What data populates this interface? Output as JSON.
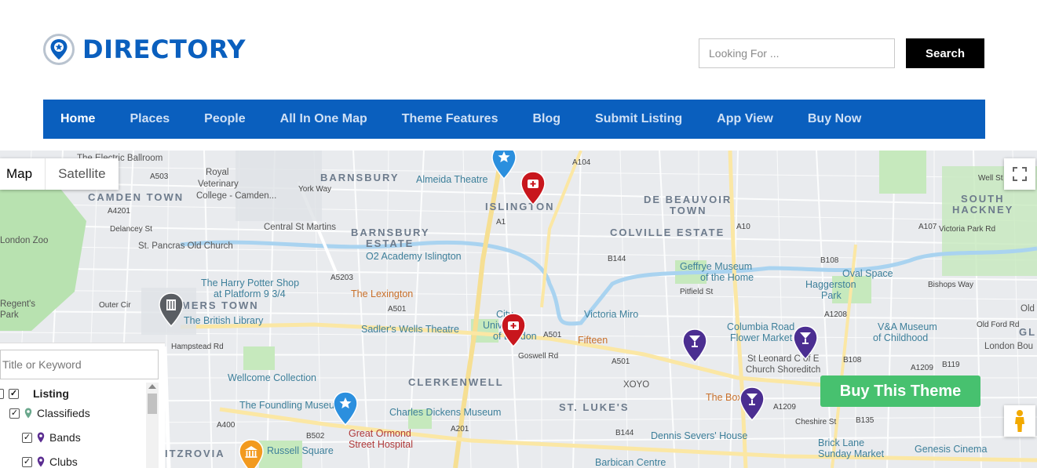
{
  "header": {
    "logo_text": "DIRECTORY",
    "search_placeholder": "Looking For ...",
    "search_button": "Search"
  },
  "nav": {
    "items": [
      "Home",
      "Places",
      "People",
      "All In One Map",
      "Theme Features",
      "Blog",
      "Submit Listing",
      "App View",
      "Buy Now"
    ],
    "active": "Home"
  },
  "map": {
    "type_controls": {
      "map": "Map",
      "satellite": "Satellite"
    },
    "buy_button": "Buy This Theme",
    "districts": [
      "CAMDEN TOWN",
      "BARNSBURY",
      "ISLINGTON",
      "DE BEAUVOIR",
      "TOWN",
      "SOUTH",
      "HACKNEY",
      "BARNSBURY",
      "ESTATE",
      "COLVILLE ESTATE",
      "MERS TOWN",
      "CLERKENWELL",
      "ST. LUKE'S",
      "ITZROVIA"
    ],
    "places": [
      "The Electric Ballroom",
      "Royal",
      "Veterinary",
      "College - Camden...",
      "Almeida Theatre",
      "Central St Martins",
      "St. Pancras Old Church",
      "O2 Academy Islington",
      "The Harry Potter Shop",
      "at Platform 9 3/4",
      "The British Library",
      "The Lexington",
      "Sadler's Wells Theatre",
      "City,",
      "University",
      "of London",
      "Victoria Miro",
      "Fifteen",
      "Geffrye Museum",
      "of the Home",
      "Haggerston",
      "Park",
      "Oval Space",
      "Columbia Road",
      "Flower Market",
      "V&A Museum",
      "of Childhood",
      "London Bou",
      "St Leonard C of E",
      "Church Shoreditch",
      "Wellcome Collection",
      "The Foundling Museum",
      "Charles Dickens Museum",
      "XOYO",
      "The Box",
      "Great Ormond",
      "Street Hospital",
      "Russell Square",
      "Dennis Severs' House",
      "Brick Lane",
      "Sunday Market",
      "Genesis Cinema",
      "Barbican Centre",
      "Regent's",
      "Park",
      "London Zoo",
      "Well St",
      "Old F",
      "Victoria Park Rd",
      "Bishops Way",
      "Old Ford Rd",
      "GL"
    ],
    "roads": [
      "A503",
      "A4201",
      "Delancey St",
      "York Way",
      "A104",
      "A1",
      "A10",
      "B144",
      "B108",
      "A5203",
      "A501",
      "A501",
      "A501",
      "A1208",
      "Pitfield St",
      "Goswell Rd",
      "Hampstead Rd",
      "A400",
      "B502",
      "A201",
      "B144",
      "A1209",
      "B119",
      "A1209",
      "Cheshire St",
      "B135",
      "B108",
      "A107",
      "Outer Cir"
    ]
  },
  "filter": {
    "keyword_placeholder": "Title or Keyword",
    "tree": [
      {
        "label": "Listing",
        "checked": true,
        "bold": true,
        "level": 0
      },
      {
        "label": "Classifieds",
        "checked": true,
        "level": 1
      },
      {
        "label": "Bands",
        "checked": true,
        "level": 2
      },
      {
        "label": "Clubs",
        "checked": true,
        "level": 2
      }
    ]
  }
}
